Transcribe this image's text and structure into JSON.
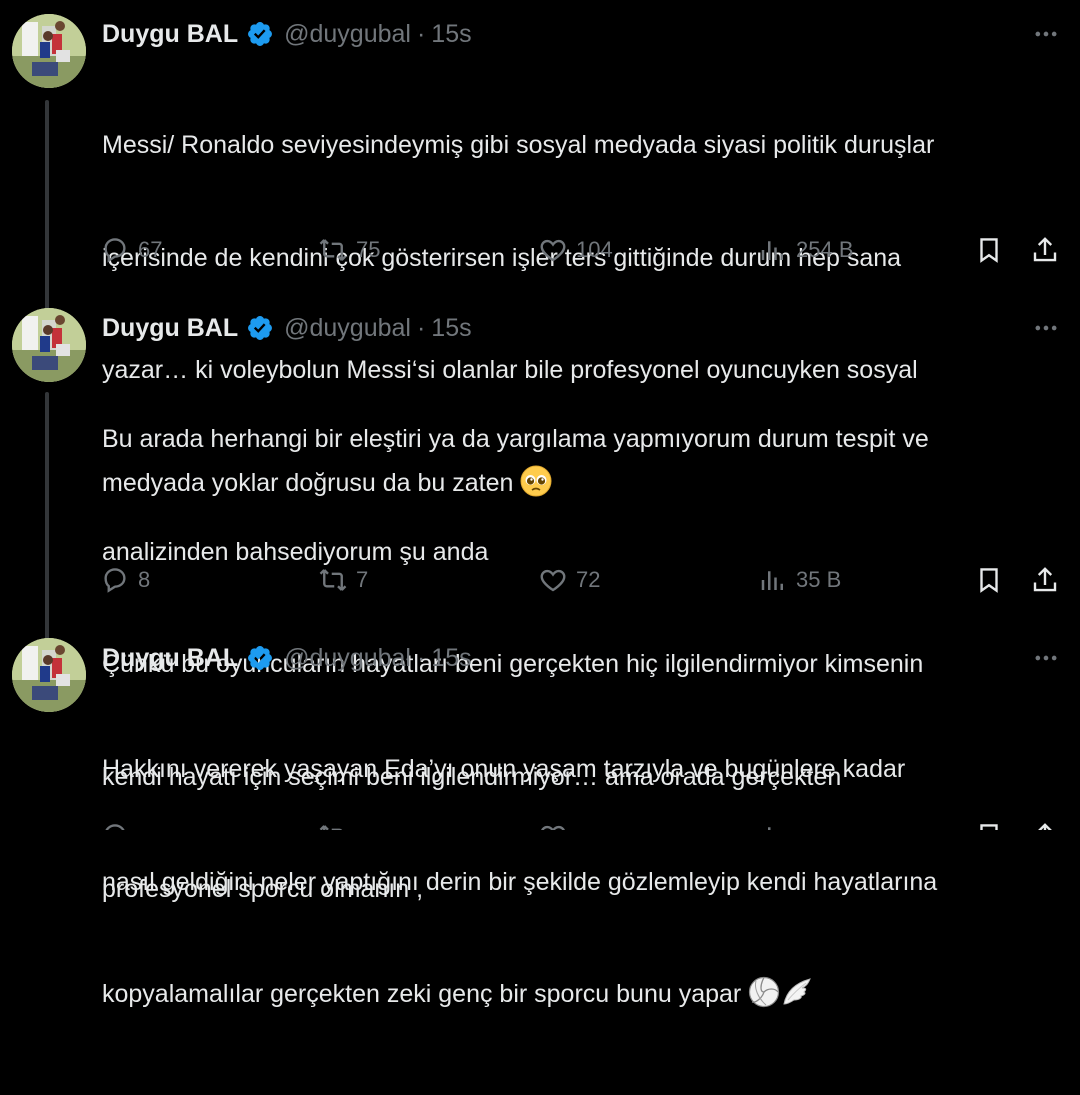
{
  "tweets": [
    {
      "name": "Duygu BAL",
      "handle": "@duygubal",
      "separator": "·",
      "time": "15s",
      "text_lines": [
        "Messi/ Ronaldo seviyesindeymiş gibi sosyal medyada siyasi politik duruşlar",
        "içerisinde de kendini çok gösterirsen işler ters gittiğinde durum hep sana",
        "yazar… ki voleybolun Messi‘si olanlar bile profesyonel oyuncuyken sosyal",
        "medyada yoklar doğrusu da bu zaten"
      ],
      "emoji": [
        "pleading-face-emoji"
      ],
      "replies": "67",
      "reposts": "75",
      "likes": "104",
      "views": "254 B"
    },
    {
      "name": "Duygu BAL",
      "handle": "@duygubal",
      "separator": "·",
      "time": "15s",
      "text_lines": [
        "Bu arada herhangi bir eleştiri ya da yargılama yapmıyorum durum tespit ve",
        "analizinden bahsediyorum şu anda",
        "Çünkü bu oyuncuların hayatları beni gerçekten hiç ilgilendirmiyor kimsenin",
        "kendi hayatı için seçimi beni ilgilendirmiyor… ama orada gerçekten",
        "profesyonel sporcu olmanın ,"
      ],
      "emoji": [],
      "replies": "8",
      "reposts": "7",
      "likes": "72",
      "views": "35 B"
    },
    {
      "name": "Duygu BAL",
      "handle": "@duygubal",
      "separator": "·",
      "time": "15s",
      "text_lines": [
        "Hakkını vererek yaşayan Eda’yı onun yaşam tarzıyla ve bugünlere kadar",
        "nasıl geldiğini neler yaptığını derin bir şekilde gözlemleyip kendi hayatlarına",
        "kopyalamalılar gerçekten zeki genç bir sporcu bunu yapar"
      ],
      "emoji": [
        "volleyball-emoji",
        "wing-emoji"
      ]
    }
  ],
  "colors": {
    "background": "#000000",
    "text": "#e7e9ea",
    "muted": "#71767b",
    "verified": "#1d9bf0",
    "thread_line": "#333639"
  },
  "icons": [
    "more-icon",
    "verified-badge-icon",
    "reply-icon",
    "repost-icon",
    "like-icon",
    "views-icon",
    "bookmark-icon",
    "share-icon"
  ]
}
